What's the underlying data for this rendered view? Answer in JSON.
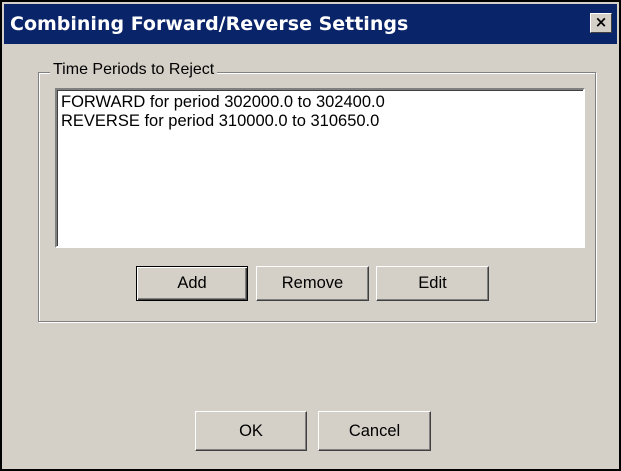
{
  "window": {
    "title": "Combining Forward/Reverse Settings",
    "close_glyph": "×"
  },
  "group": {
    "label": "Time Periods to Reject",
    "items": [
      "FORWARD for period 302000.0 to 302400.0",
      "REVERSE for period 310000.0 to 310650.0"
    ]
  },
  "buttons": {
    "add": "Add",
    "remove": "Remove",
    "edit": "Edit",
    "ok": "OK",
    "cancel": "Cancel"
  },
  "colors": {
    "title_bar": "#0a246a",
    "dialog_face": "#d4d0c8",
    "list_background": "#ffffff"
  },
  "icons": {
    "close": "close-icon"
  }
}
